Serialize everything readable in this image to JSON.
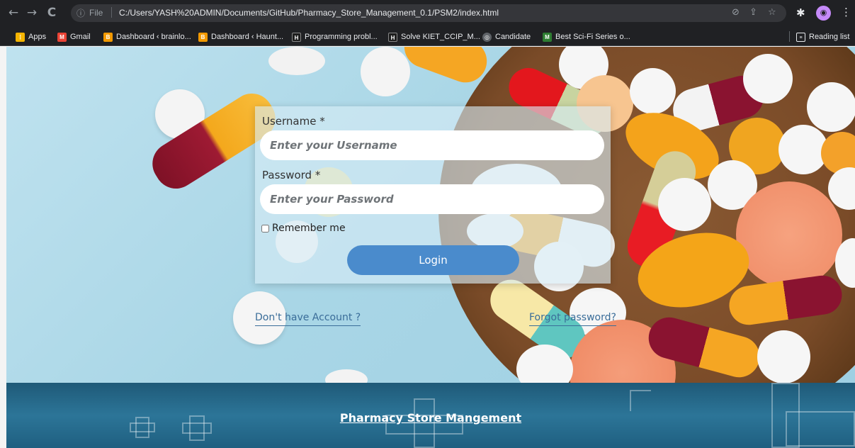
{
  "browser": {
    "nav": {
      "back_icon": "arrow-left-icon",
      "forward_icon": "arrow-right-icon",
      "reload_icon": "reload-icon"
    },
    "address": {
      "scheme_label": "File",
      "url": "C:/Users/YASH%20ADMIN/Documents/GitHub/Pharmacy_Store_Management_0.1/PSM2/index.html"
    },
    "bookmarks": [
      {
        "label": "Apps",
        "icon": "apps-grid-icon",
        "color": "#f4b400"
      },
      {
        "label": "Gmail",
        "icon": "gmail-icon",
        "color": "#ea4335"
      },
      {
        "label": "Dashboard ‹ brainlo...",
        "icon": "site-icon",
        "color": "#f29900"
      },
      {
        "label": "Dashboard ‹ Haunt...",
        "icon": "site-icon",
        "color": "#f29900"
      },
      {
        "label": "Programming probl...",
        "icon": "site-icon",
        "color": "#1e1e1e"
      },
      {
        "label": "Solve KIET_CCIP_M...",
        "icon": "site-icon",
        "color": "#1e1e1e"
      },
      {
        "label": "Candidate",
        "icon": "globe-icon",
        "color": "#5f6368"
      },
      {
        "label": "Best Sci-Fi Series o...",
        "icon": "site-icon",
        "color": "#2e7d32"
      }
    ],
    "reading_list": "Reading list"
  },
  "login": {
    "username_label": "Username *",
    "username_placeholder": "Enter your Username",
    "password_label": "Password *",
    "password_placeholder": "Enter your Password",
    "remember_label": "Remember me",
    "login_button": "Login"
  },
  "links": {
    "signup": "Don't have Account ?",
    "forgot": "Forgot password?"
  },
  "footer": {
    "title": "Pharmacy Store Mangement"
  },
  "colors": {
    "primary_button": "#4a8bcc",
    "footer_bg": "#2c7598",
    "link": "#3a6d99"
  }
}
